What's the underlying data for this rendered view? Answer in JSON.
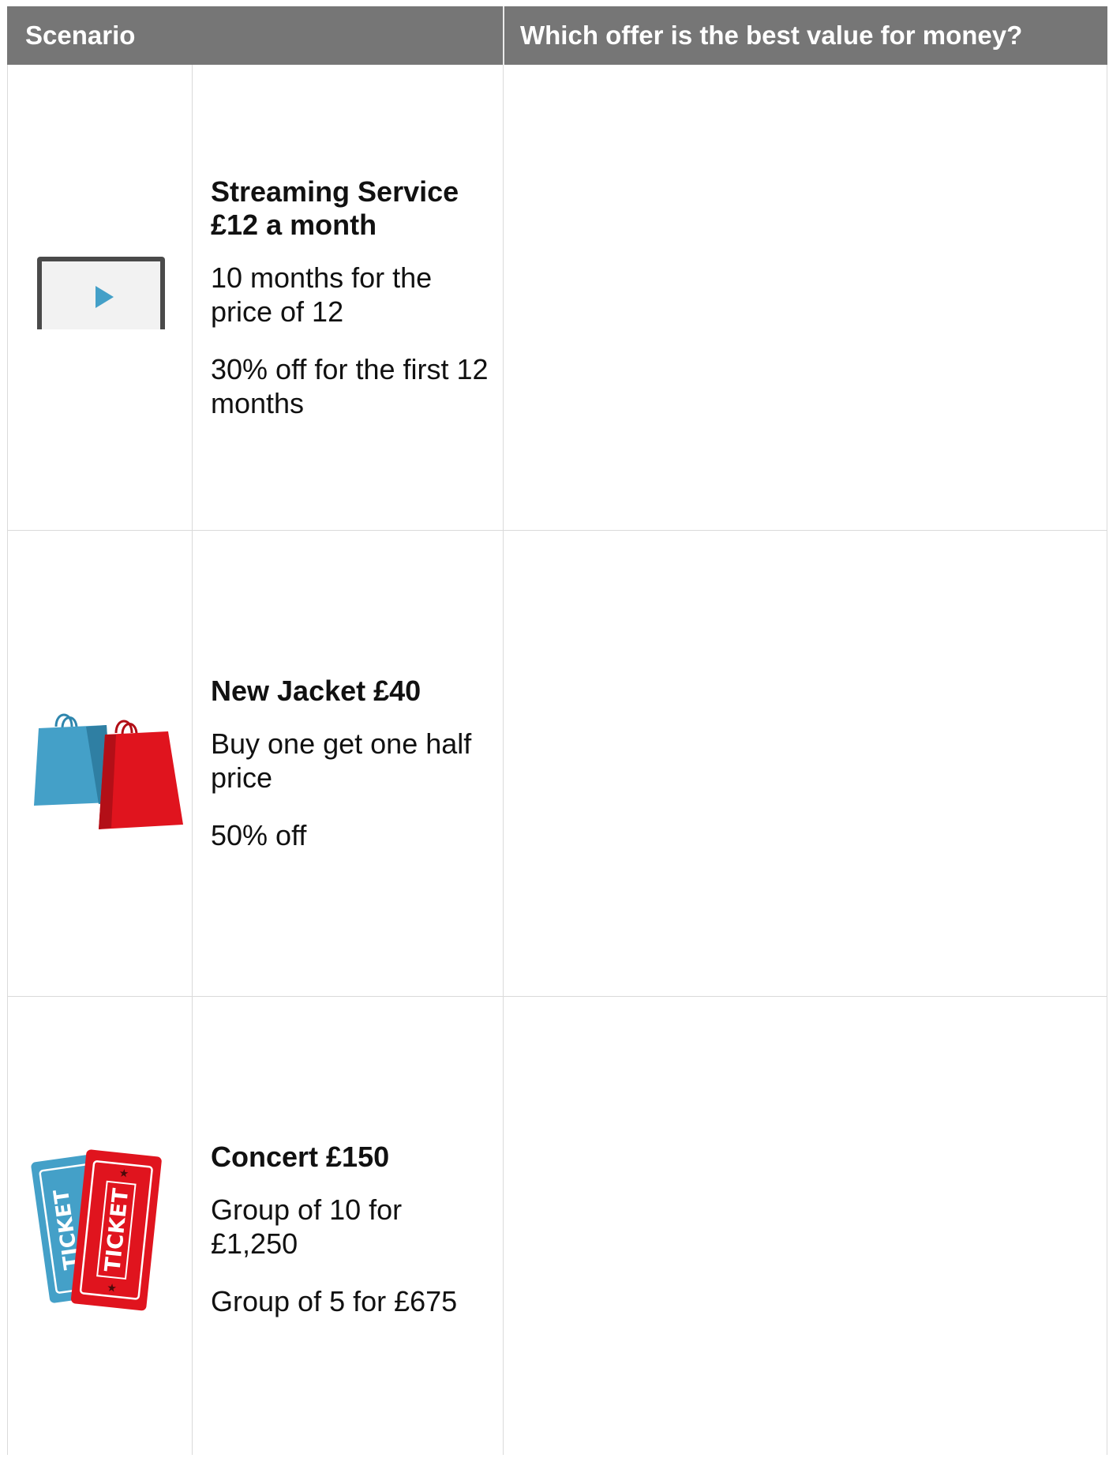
{
  "table": {
    "headers": {
      "scenario": "Scenario",
      "question": "Which offer is the best value for money?"
    },
    "rows": [
      {
        "icon": "laptop-play-icon",
        "title_line1": "Streaming Service",
        "title_line2": "£12 a month",
        "option1": "10 months for the price of 12",
        "option2": "30% off for the first 12 months",
        "answer": ""
      },
      {
        "icon": "shopping-bags-icon",
        "title": "New Jacket £40",
        "option1": "Buy one get one half price",
        "option2": "50% off",
        "answer": ""
      },
      {
        "icon": "tickets-icon",
        "title": "Concert £150",
        "option1": "Group of 10 for £1,250",
        "option2": "Group of 5 for £675",
        "answer": ""
      }
    ]
  },
  "icons": {
    "ticket_text": "TICKET"
  },
  "colors": {
    "header_bg": "#767676",
    "accent_blue": "#44a0c8",
    "accent_red": "#e0141e",
    "laptop_frame": "#4a4a4a"
  }
}
